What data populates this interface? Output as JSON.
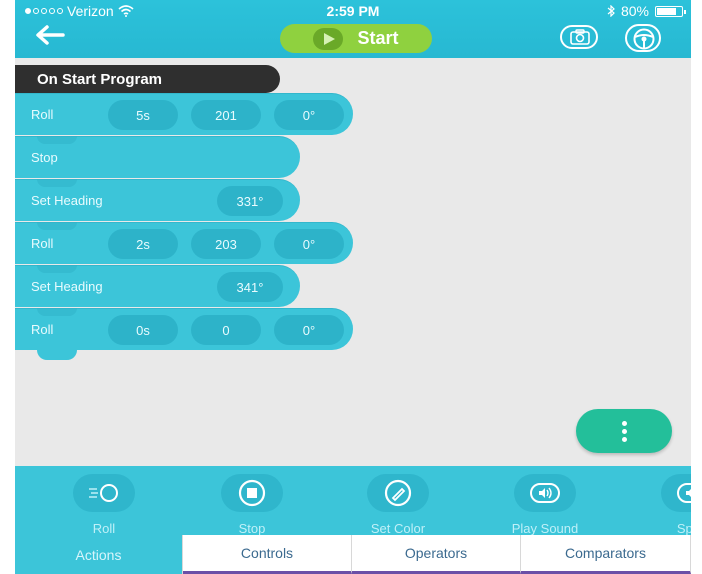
{
  "status_bar": {
    "carrier": "Verizon",
    "time": "2:59 PM",
    "battery": "80%",
    "battery_level": 0.8
  },
  "header": {
    "start_label": "Start",
    "icons": [
      "back-arrow-icon",
      "play-icon",
      "camera-icon",
      "steering-wheel-icon"
    ]
  },
  "program": {
    "title": "On Start Program",
    "blocks": [
      {
        "label": "Roll",
        "params": [
          "5s",
          "201",
          "0°"
        ]
      },
      {
        "label": "Stop",
        "params": []
      },
      {
        "label": "Set Heading",
        "params": [
          "331°"
        ]
      },
      {
        "label": "Roll",
        "params": [
          "2s",
          "203",
          "0°"
        ]
      },
      {
        "label": "Set Heading",
        "params": [
          "341°"
        ]
      },
      {
        "label": "Roll",
        "params": [
          "0s",
          "0",
          "0°"
        ]
      }
    ]
  },
  "palette": {
    "items": [
      {
        "label": "Roll",
        "icon": "roll-icon"
      },
      {
        "label": "Stop",
        "icon": "stop-icon"
      },
      {
        "label": "Set Color",
        "icon": "color-icon"
      },
      {
        "label": "Play Sound",
        "icon": "sound-icon"
      },
      {
        "label": "Spea",
        "icon": "speak-icon"
      }
    ]
  },
  "tabs": [
    {
      "label": "Actions",
      "active": true
    },
    {
      "label": "Controls",
      "active": false
    },
    {
      "label": "Operators",
      "active": false
    },
    {
      "label": "Comparators",
      "active": false
    }
  ],
  "colors": {
    "accent": "#3cc5d9",
    "start_green": "#8fd13f",
    "fab_green": "#23bf9a",
    "tab_underline": "#6b4fa7"
  }
}
